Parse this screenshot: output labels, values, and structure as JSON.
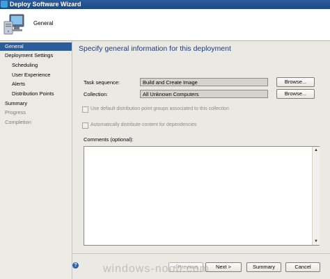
{
  "window": {
    "title": "Deploy Software Wizard"
  },
  "header": {
    "page_title": "General"
  },
  "sidebar": {
    "items": [
      {
        "label": "General",
        "active": true
      },
      {
        "label": "Deployment Settings"
      },
      {
        "label": "Scheduling"
      },
      {
        "label": "User Experience"
      },
      {
        "label": "Alerts"
      },
      {
        "label": "Distribution Points"
      },
      {
        "label": "Summary"
      },
      {
        "label": "Progress"
      },
      {
        "label": "Completion"
      }
    ]
  },
  "main": {
    "heading": "Specify general information for this deployment",
    "task_sequence": {
      "label": "Task sequence:",
      "value": "Build and Create Image",
      "browse_label": "Browse..."
    },
    "collection": {
      "label": "Collection:",
      "value": "All Unknown Computers",
      "browse_label": "Browse..."
    },
    "use_default_dp_groups": {
      "label": "Use default distribution point groups associated to this collection",
      "checked": false
    },
    "auto_distribute": {
      "label": "Automatically distribute content for dependencies",
      "checked": false
    },
    "comments": {
      "label": "Comments (optional):",
      "value": ""
    }
  },
  "footer": {
    "previous_label": "< Previous",
    "next_label": "Next >",
    "summary_label": "Summary",
    "cancel_label": "Cancel",
    "help_symbol": "?"
  },
  "watermark": "windows-noob.com",
  "colors": {
    "accent": "#2b5d9c",
    "heading": "#1d3a78",
    "panel": "#ebe9e4"
  },
  "icons": {
    "titlebar": "app-icon",
    "header": "computer-icon",
    "help": "help-icon"
  }
}
